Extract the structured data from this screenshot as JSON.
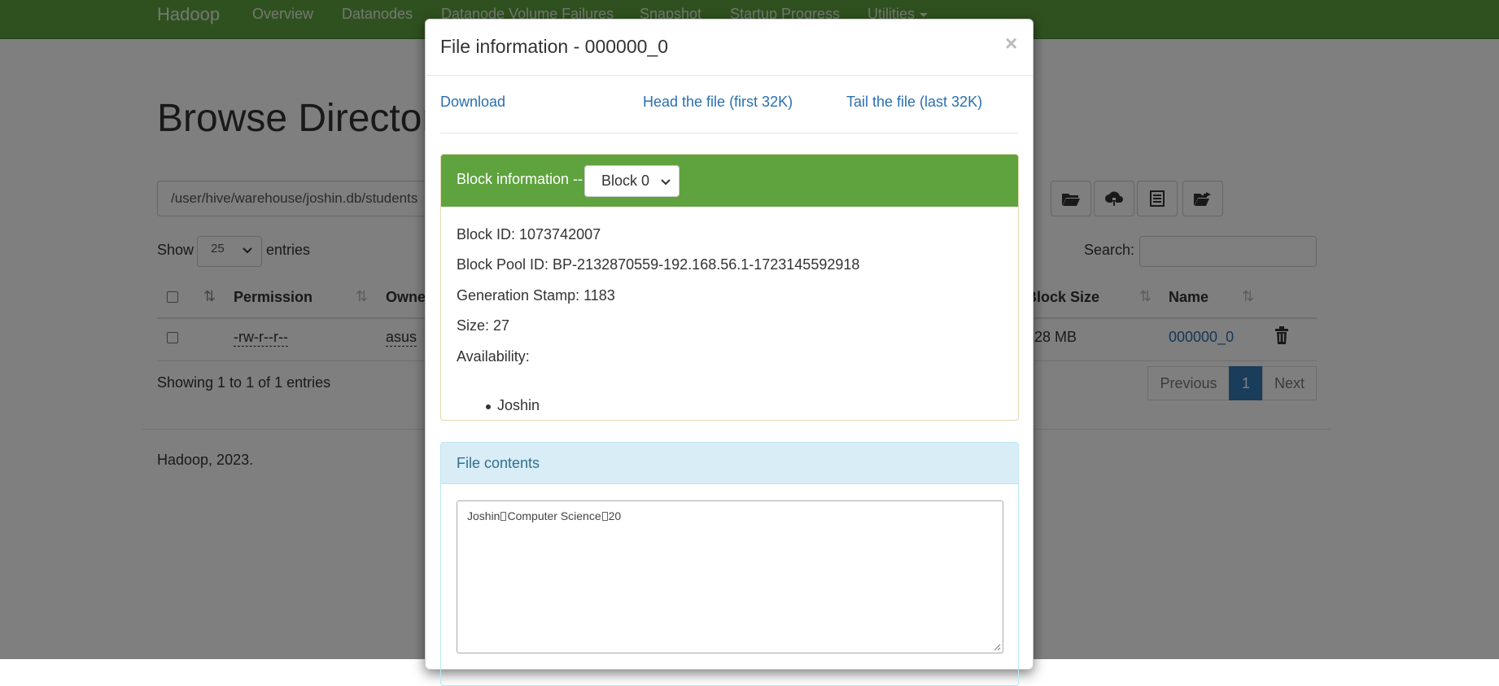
{
  "navbar": {
    "brand": "Hadoop",
    "items": [
      "Overview",
      "Datanodes",
      "Datanode Volume Failures",
      "Snapshot",
      "Startup Progress",
      "Utilities"
    ]
  },
  "page": {
    "title": "Browse Directory",
    "path_value": "/user/hive/warehouse/joshin.db/students",
    "show_label": "Show",
    "show_value": "25",
    "entries_label": "entries",
    "search_label": "Search:",
    "search_value": "",
    "columns": [
      "Permission",
      "Owner",
      "Block Size",
      "Name"
    ],
    "rows": [
      {
        "permission": "-rw-r--r--",
        "owner": "asus",
        "block_size": "128 MB",
        "name": "000000_0"
      }
    ],
    "showing_text": "Showing 1 to 1 of 1 entries",
    "pagination": {
      "previous": "Previous",
      "current": "1",
      "next": "Next"
    },
    "footer": "Hadoop, 2023."
  },
  "modal": {
    "title": "File information - 000000_0",
    "close": "×",
    "actions": {
      "download": "Download",
      "head": "Head the file (first 32K)",
      "tail": "Tail the file (last 32K)"
    },
    "block": {
      "heading": "Block information --",
      "selected_block": "Block 0",
      "block_id": "Block ID: 1073742007",
      "pool_id": "Block Pool ID: BP-2132870559-192.168.56.1-1723145592918",
      "generation_stamp": "Generation Stamp: 1183",
      "size": "Size: 27",
      "availability_label": "Availability:",
      "availability": [
        "Joshin"
      ]
    },
    "contents": {
      "heading": "File contents",
      "fields": [
        "Joshin",
        "Computer Science",
        "20"
      ]
    }
  },
  "colors": {
    "navbar": "#5fa33e",
    "link": "#2a6fb0",
    "primary": "#337ab7",
    "info_panel": "#d9edf7"
  }
}
